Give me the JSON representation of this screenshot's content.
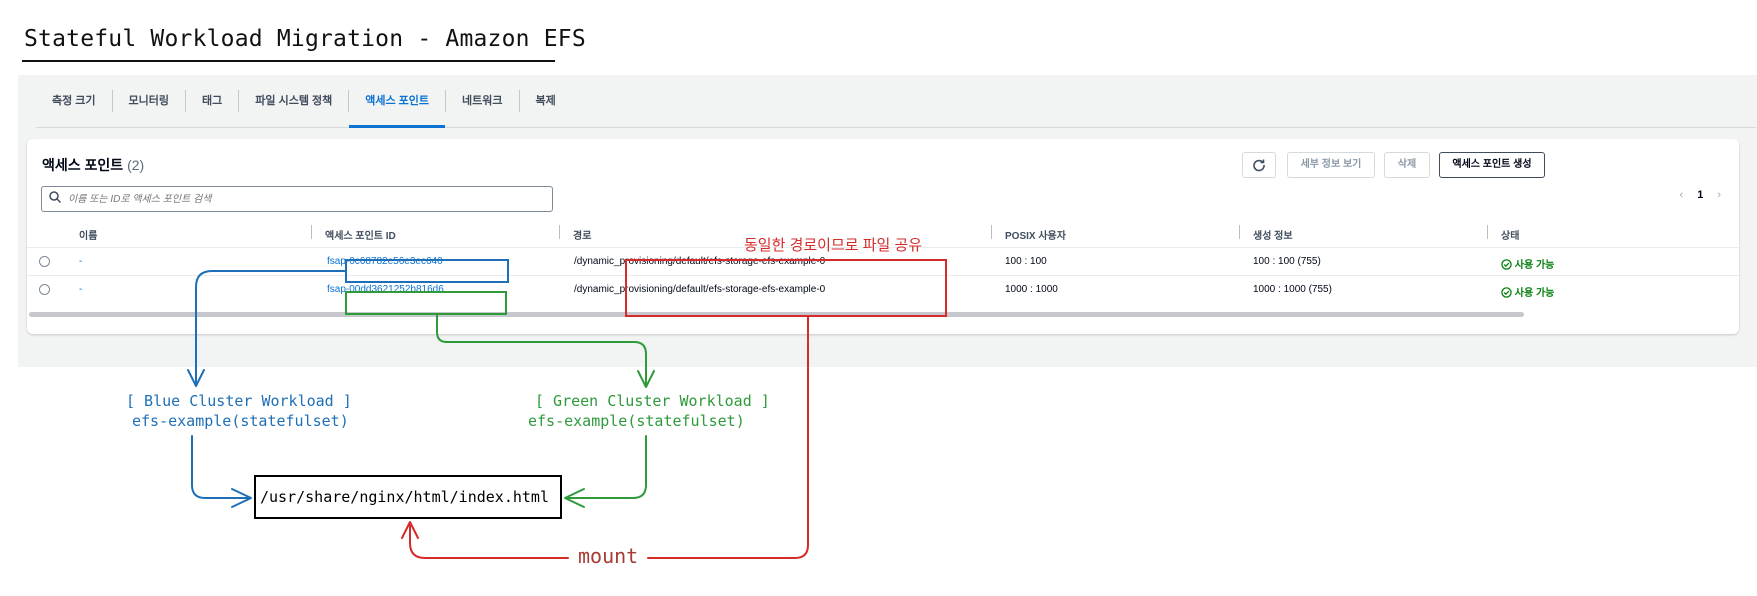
{
  "title": "Stateful Workload Migration - Amazon EFS",
  "tabs": [
    "측정 크기",
    "모니터링",
    "태그",
    "파일 시스템 정책",
    "액세스 포인트",
    "네트워크",
    "복제"
  ],
  "active_tab": "액세스 포인트",
  "panel": {
    "header": "액세스 포인트",
    "count": "(2)",
    "search_placeholder": "이름 또는 ID로 액세스 포인트 검색",
    "buttons": {
      "details": "세부 정보 보기",
      "delete": "삭제",
      "create": "액세스 포인트 생성"
    },
    "page": "1"
  },
  "columns": [
    "이름",
    "액세스 포인트 ID",
    "경로",
    "POSIX 사용자",
    "생성 정보",
    "상태"
  ],
  "rows": [
    {
      "name": "-",
      "id": "fsap-0c68782e56e3ec640",
      "path": "/dynamic_provisioning/default/efs-storage-efs-example-0",
      "posix": "100 : 100",
      "creation": "100 : 100 (755)",
      "status": "사용 가능"
    },
    {
      "name": "-",
      "id": "fsap-00dd3621252b816d6",
      "path": "/dynamic_provisioning/default/efs-storage-efs-example-0",
      "posix": "1000 : 1000",
      "creation": "1000 : 1000 (755)",
      "status": "사용 가능"
    }
  ],
  "annotations": {
    "shared_path_note": "동일한 경로이므로 파일 공유",
    "blue": {
      "title": "[ Blue Cluster Workload ]",
      "subtitle": "efs-example(statefulset)"
    },
    "green": {
      "title": "[ Green Cluster Workload ]",
      "subtitle": "efs-example(statefulset)"
    },
    "file": "/usr/share/nginx/html/index.html",
    "mount": "mount"
  },
  "colors": {
    "blue": "#1f6fb8",
    "green": "#2e9a3a",
    "red": "#d52b2b",
    "aws_link": "#0972d3",
    "ok": "#037f0c"
  },
  "icons": [
    "refresh-icon",
    "search-icon",
    "check-circle-icon",
    "chevron-left-icon",
    "chevron-right-icon",
    "radio-icon"
  ]
}
